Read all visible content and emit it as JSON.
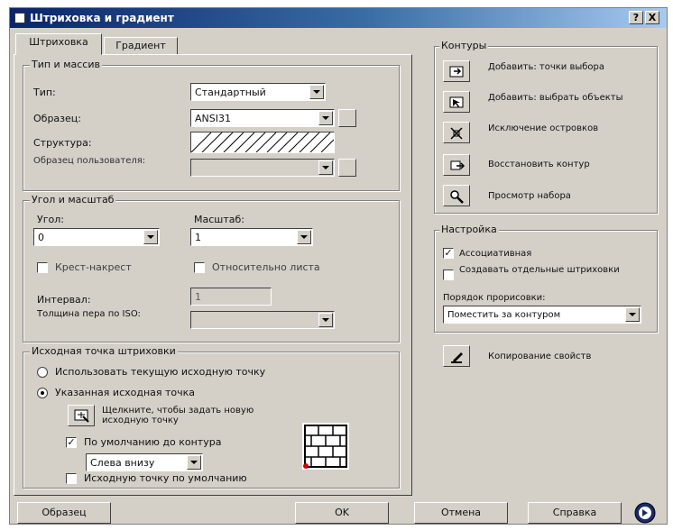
{
  "window": {
    "title": "Штриховка и градиент",
    "help_btn": "?",
    "close_btn": "X"
  },
  "tabs": [
    {
      "label": "Штриховка"
    },
    {
      "label": "Градиент"
    }
  ],
  "type_group": {
    "title": "Тип и массив",
    "type_label": "Тип:",
    "type_value": "Стандартный",
    "pattern_label": "Образец:",
    "pattern_value": "ANSI31",
    "swatch_label": "Структура:",
    "custom_label": "Образец пользователя:",
    "custom_value": ""
  },
  "angle_group": {
    "title": "Угол и масштаб",
    "angle_label": "Угол:",
    "angle_value": "0",
    "scale_label": "Масштаб:",
    "scale_value": "1",
    "cross_label": "Крест-накрест",
    "relative_label": "Относительно листа",
    "spacing_label": "Интервал:",
    "spacing_value": "1",
    "iso_label": "Толщина пера по ISO:",
    "iso_value": ""
  },
  "origin_group": {
    "title": "Исходная точка штриховки",
    "use_current": "Использовать текущую исходную точку",
    "specified": "Указанная исходная точка",
    "click_text": "Щелкните, чтобы задать новую исходную точку",
    "default_extents": "По умолчанию до контура",
    "position_value": "Слева внизу",
    "store_default": "Исходную точку по умолчанию"
  },
  "boundary_group": {
    "title": "Контуры",
    "add_points": "Добавить: точки выбора",
    "add_objects": "Добавить: выбрать объекты",
    "remove_islands": "Исключение островков",
    "recreate": "Восстановить контур",
    "view": "Просмотр набора"
  },
  "options_group": {
    "title": "Настройка",
    "associative": "Ассоциативная",
    "separate": "Создавать отдельные штриховки",
    "draw_order_label": "Порядок прорисовки:",
    "draw_order_value": "Поместить за контуром"
  },
  "inherit": "Копирование свойств",
  "buttons": {
    "preview": "Образец",
    "ok": "OK",
    "cancel": "Отмена",
    "help": "Справка"
  },
  "icons": {
    "add_points": "pick-points-icon",
    "add_objects": "select-objects-icon",
    "remove": "remove-islands-icon",
    "recreate": "recreate-boundary-icon",
    "view": "magnifier-icon",
    "inherit": "inherit-brush-icon",
    "pick_origin": "pick-origin-icon",
    "brick_preview": "brick-pattern-icon",
    "more": "arrow-circle-icon"
  }
}
